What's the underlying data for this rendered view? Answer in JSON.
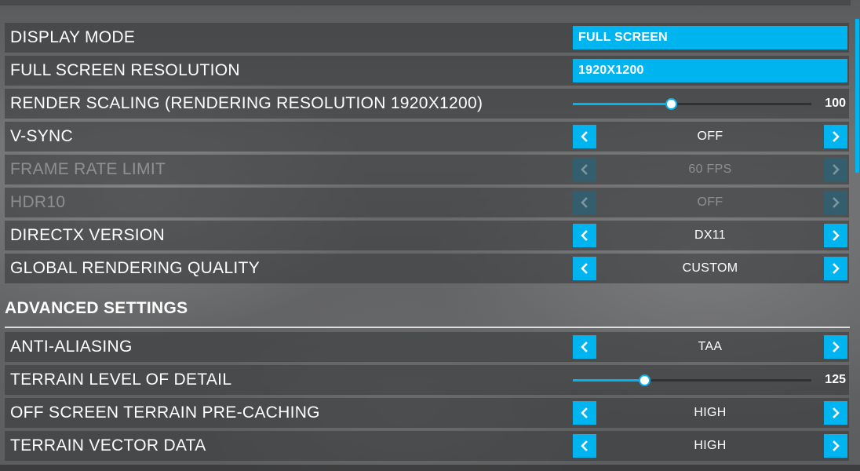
{
  "settings": [
    {
      "label": "DISPLAY MODE",
      "control": "dropdown",
      "value": "FULL SCREEN",
      "enabled": true
    },
    {
      "label": "FULL SCREEN RESOLUTION",
      "control": "dropdown",
      "value": "1920X1200",
      "enabled": true
    },
    {
      "label": "RENDER SCALING (RENDERING RESOLUTION 1920X1200)",
      "control": "slider",
      "value": "100",
      "fraction": 0.41,
      "enabled": true
    },
    {
      "label": "V-SYNC",
      "control": "selector",
      "value": "OFF",
      "enabled": true
    },
    {
      "label": "FRAME RATE LIMIT",
      "control": "selector",
      "value": "60 FPS",
      "enabled": false
    },
    {
      "label": "HDR10",
      "control": "selector",
      "value": "OFF",
      "enabled": false
    },
    {
      "label": "DIRECTX VERSION",
      "control": "selector",
      "value": "DX11",
      "enabled": true
    },
    {
      "label": "GLOBAL RENDERING QUALITY",
      "control": "selector",
      "value": "CUSTOM",
      "enabled": true
    }
  ],
  "advanced": {
    "heading": "ADVANCED SETTINGS",
    "settings": [
      {
        "label": "ANTI-ALIASING",
        "control": "selector",
        "value": "TAA",
        "enabled": true
      },
      {
        "label": "TERRAIN LEVEL OF DETAIL",
        "control": "slider",
        "value": "125",
        "fraction": 0.3,
        "enabled": true
      },
      {
        "label": "OFF SCREEN TERRAIN PRE-CACHING",
        "control": "selector",
        "value": "HIGH",
        "enabled": true
      },
      {
        "label": "TERRAIN VECTOR DATA",
        "control": "selector",
        "value": "HIGH",
        "enabled": true
      }
    ]
  },
  "icons": {
    "prev": "chevron-left-icon",
    "next": "chevron-right-icon"
  },
  "colors": {
    "accent": "#00b4f0",
    "row_background": "#3a3b3d",
    "text": "#ffffff"
  }
}
